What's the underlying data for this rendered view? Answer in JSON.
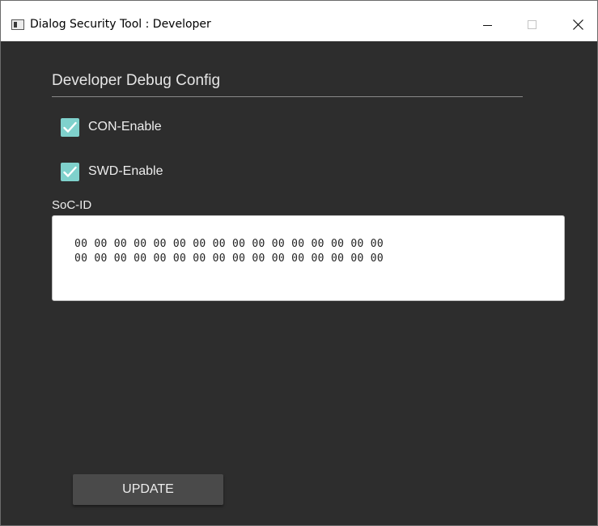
{
  "window": {
    "title": "Dialog Security Tool : Developer"
  },
  "titlebar": {
    "app_icon": "app-window-icon",
    "minimize_icon": "minimize-icon",
    "maximize_icon": "maximize-icon",
    "close_icon": "close-icon"
  },
  "config": {
    "section_title": "Developer Debug Config",
    "con_enable": {
      "label": "CON-Enable",
      "checked": true
    },
    "swd_enable": {
      "label": "SWD-Enable",
      "checked": true
    },
    "socid": {
      "label": "SoC-ID",
      "line1": "00 00 00 00 00 00 00 00 00 00 00 00 00 00 00 00",
      "line2": "00 00 00 00 00 00 00 00 00 00 00 00 00 00 00 00"
    },
    "update_label": "UPDATE"
  },
  "colors": {
    "background": "#2d2d2d",
    "checkbox_accent": "#7fd1cc",
    "button_bg": "#4a4a4a",
    "text": "#ededed"
  }
}
